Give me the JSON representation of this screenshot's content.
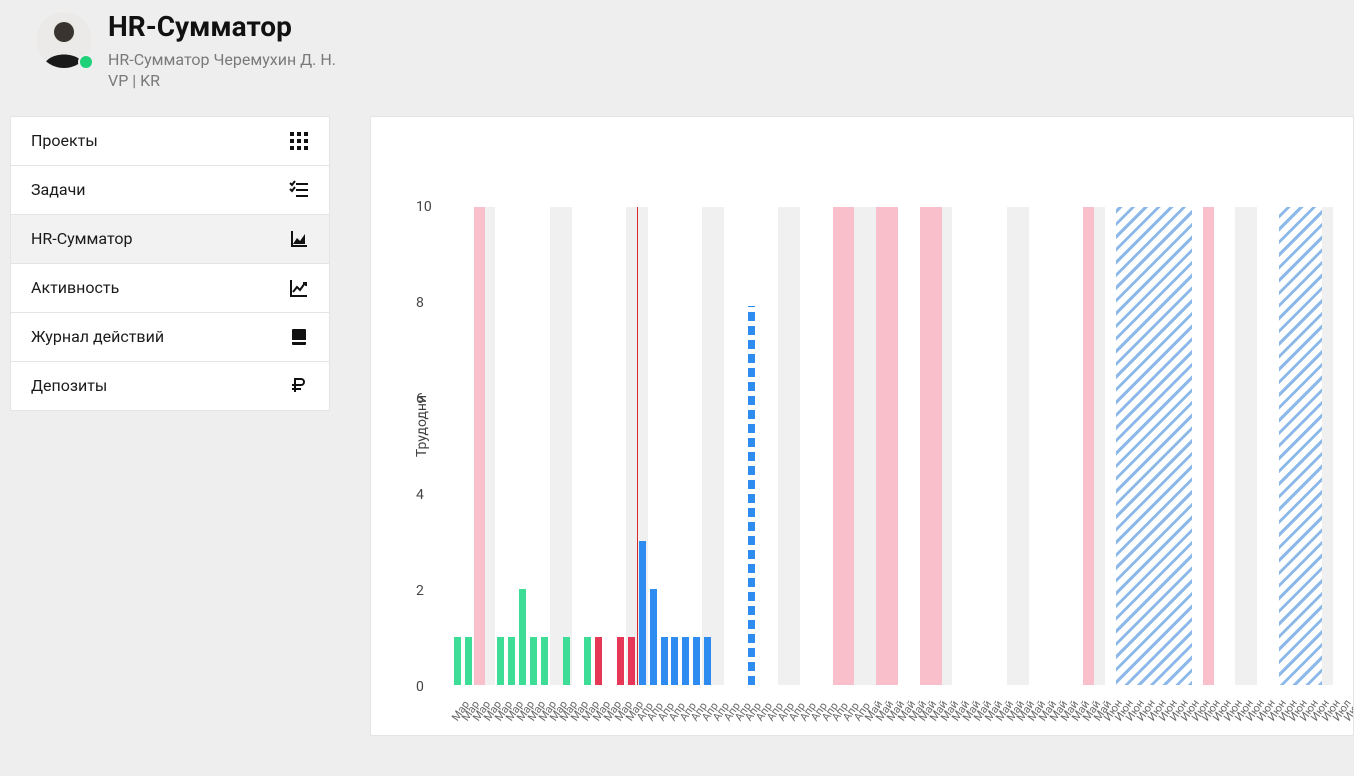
{
  "header": {
    "title": "HR-Сумматор",
    "subtitle_line1": "HR-Сумматор Черемухин Д. Н.",
    "subtitle_line2": "VP | KR"
  },
  "sidebar": {
    "items": [
      {
        "label": "Проекты",
        "icon": "grid-icon",
        "active": false
      },
      {
        "label": "Задачи",
        "icon": "checklist-icon",
        "active": false
      },
      {
        "label": "HR-Сумматор",
        "icon": "area-chart-icon",
        "active": true
      },
      {
        "label": "Активность",
        "icon": "line-chart-icon",
        "active": false
      },
      {
        "label": "Журнал действий",
        "icon": "book-icon",
        "active": false
      },
      {
        "label": "Депозиты",
        "icon": "ruble-icon",
        "active": false
      }
    ]
  },
  "chart_data": {
    "type": "bar",
    "ylabel": "Трудодни",
    "ylim": [
      0,
      10
    ],
    "y_ticks": [
      0,
      2,
      4,
      6,
      8,
      10
    ],
    "x_tick_label_cycle": [
      "Мар",
      "Апр",
      "Май",
      "Июн",
      "Июл"
    ],
    "x_months": [
      "Мар",
      "Мар",
      "Мар",
      "Мар",
      "Мар",
      "Мар",
      "Мар",
      "Мар",
      "Мар",
      "Мар",
      "Мар",
      "Мар",
      "Мар",
      "Мар",
      "Мар",
      "Мар",
      "Мар",
      "Апр",
      "Апр",
      "Апр",
      "Апр",
      "Апр",
      "Апр",
      "Апр",
      "Апр",
      "Апр",
      "Апр",
      "Апр",
      "Апр",
      "Апр",
      "Апр",
      "Апр",
      "Апр",
      "Апр",
      "Апр",
      "Апр",
      "Апр",
      "Апр",
      "Май",
      "Май",
      "Май",
      "Май",
      "Май",
      "Май",
      "Май",
      "Май",
      "Май",
      "Май",
      "Май",
      "Май",
      "Май",
      "Май",
      "Май",
      "Май",
      "Май",
      "Май",
      "Май",
      "Май",
      "Май",
      "Май",
      "Июн",
      "Июн",
      "Июн",
      "Июн",
      "Июн",
      "Июн",
      "Июн",
      "Июн",
      "Июн",
      "Июн",
      "Июн",
      "Июн",
      "Июн",
      "Июн",
      "Июн",
      "Июн",
      "Июн",
      "Июн",
      "Июн",
      "Июн",
      "Июн",
      "Июл",
      "Июл",
      "Июл"
    ],
    "colors": {
      "green": "#3ddc97",
      "red": "#e63757",
      "blue": "#2e8bf0",
      "pink_band": "#f9c0cb",
      "hatched_future": "#8cb9ea",
      "weekend_bg": "#f0f0f0"
    },
    "today_index": 18,
    "weekend_indices": [
      3,
      4,
      10,
      11,
      17,
      18,
      24,
      25,
      31,
      32,
      38,
      39,
      45,
      46,
      52,
      53,
      59,
      60,
      66,
      67,
      73,
      74,
      80,
      81
    ],
    "pink_band_indices": [
      3,
      36,
      37,
      40,
      41,
      44,
      45,
      59,
      70
    ],
    "hatched_future_ranges": [
      [
        62,
        68
      ],
      [
        77,
        80
      ]
    ],
    "series": [
      {
        "name": "green",
        "points": [
          {
            "i": 1,
            "v": 1
          },
          {
            "i": 2,
            "v": 1
          },
          {
            "i": 5,
            "v": 1
          },
          {
            "i": 6,
            "v": 1
          },
          {
            "i": 7,
            "v": 2
          },
          {
            "i": 8,
            "v": 1
          },
          {
            "i": 9,
            "v": 1
          },
          {
            "i": 11,
            "v": 1
          },
          {
            "i": 13,
            "v": 1
          }
        ]
      },
      {
        "name": "red",
        "points": [
          {
            "i": 14,
            "v": 1
          },
          {
            "i": 16,
            "v": 1
          },
          {
            "i": 17,
            "v": 1
          }
        ]
      },
      {
        "name": "blue",
        "points": [
          {
            "i": 18,
            "v": 3
          },
          {
            "i": 19,
            "v": 2
          },
          {
            "i": 20,
            "v": 1
          },
          {
            "i": 21,
            "v": 1
          },
          {
            "i": 22,
            "v": 1
          },
          {
            "i": 23,
            "v": 1
          },
          {
            "i": 24,
            "v": 1
          }
        ]
      },
      {
        "name": "blue_dashed",
        "points": [
          {
            "i": 28,
            "v": 7.9
          }
        ]
      }
    ]
  }
}
